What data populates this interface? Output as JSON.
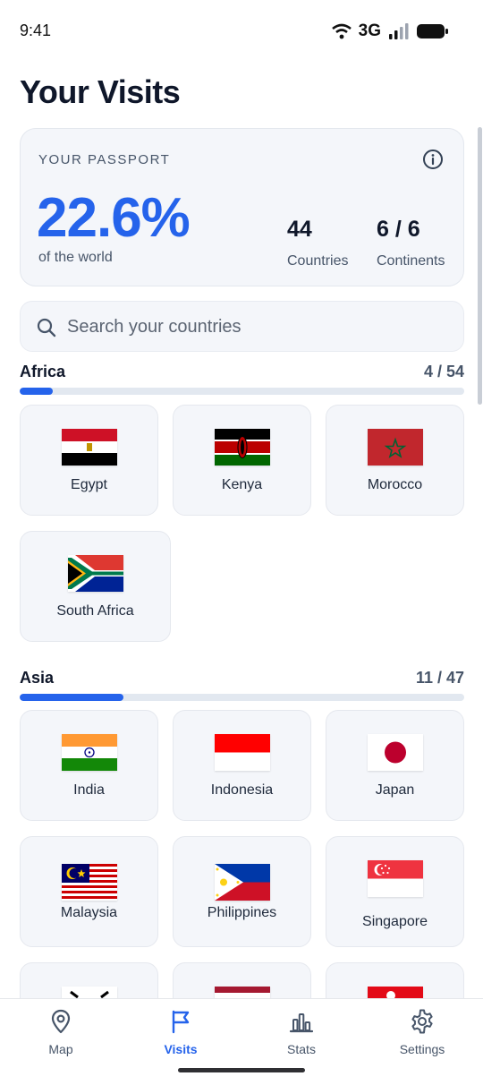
{
  "status": {
    "time": "9:41",
    "network": "3G"
  },
  "page_title": "Your Visits",
  "passport": {
    "label": "YOUR PASSPORT",
    "percent": "22.6%",
    "percent_sub": "of the world",
    "countries_value": "44",
    "countries_label": "Countries",
    "continents_value": "6 / 6",
    "continents_label": "Continents"
  },
  "search": {
    "placeholder": "Search your countries",
    "value": ""
  },
  "sections": [
    {
      "name": "Africa",
      "count": "4 / 54",
      "progress": 0.074,
      "countries": [
        "Egypt",
        "Kenya",
        "Morocco",
        "South Africa"
      ]
    },
    {
      "name": "Asia",
      "count": "11 / 47",
      "progress": 0.234,
      "countries": [
        "India",
        "Indonesia",
        "Japan",
        "Malaysia",
        "Philippines",
        "Singapore"
      ]
    }
  ],
  "nav": [
    {
      "label": "Map",
      "icon": "map-pin-icon",
      "active": false
    },
    {
      "label": "Visits",
      "icon": "flag-icon",
      "active": true
    },
    {
      "label": "Stats",
      "icon": "bar-chart-icon",
      "active": false
    },
    {
      "label": "Settings",
      "icon": "gear-icon",
      "active": false
    }
  ],
  "colors": {
    "accent": "#2563eb",
    "card_bg": "#f4f6fa",
    "text_primary": "#0f172a",
    "text_secondary": "#475569"
  }
}
